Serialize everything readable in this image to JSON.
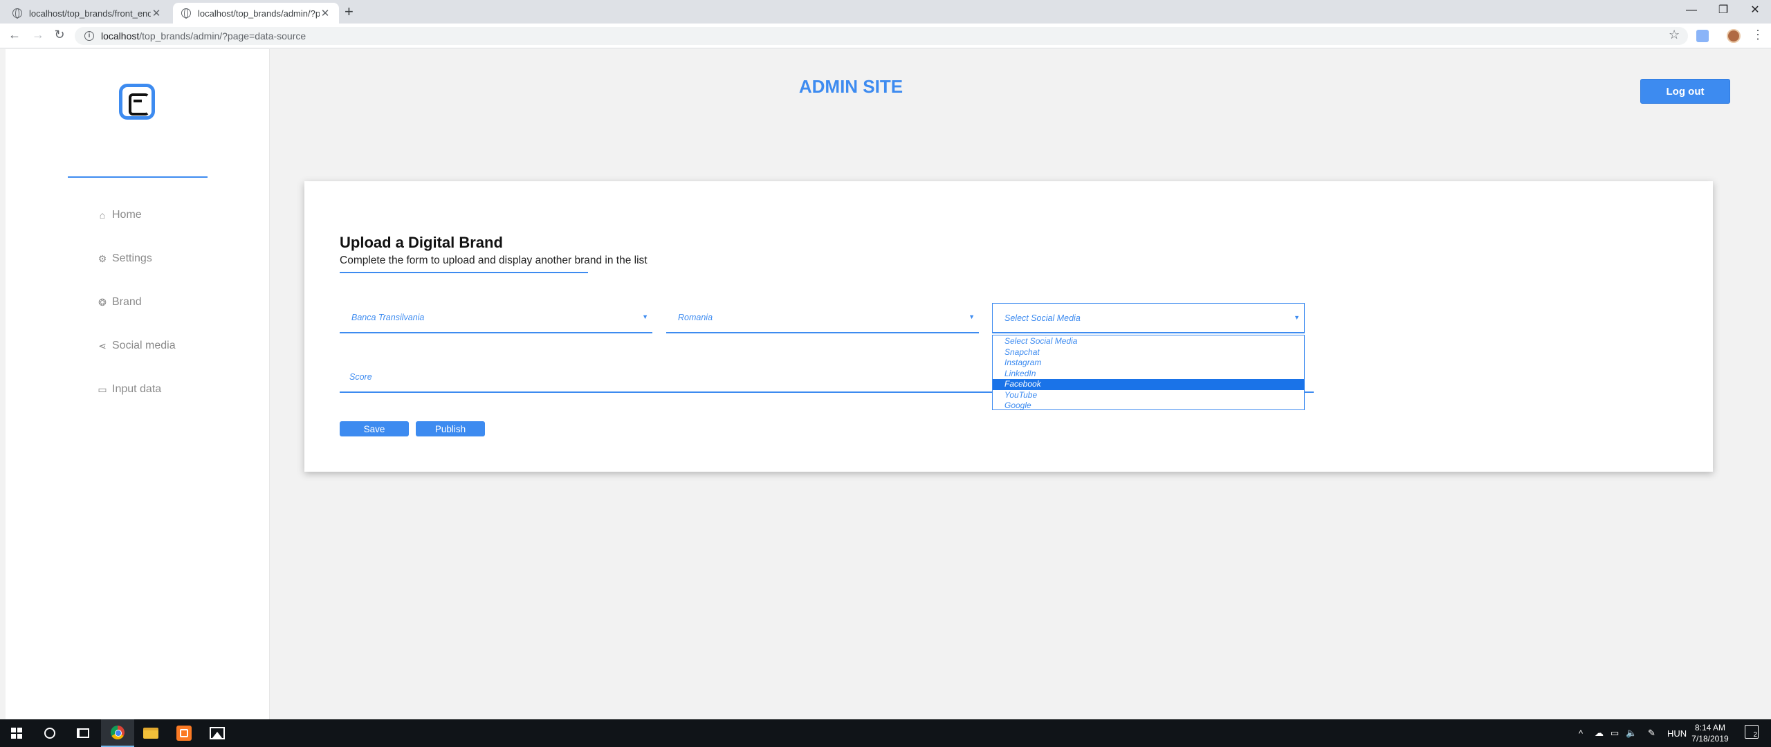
{
  "browser": {
    "tabs": [
      {
        "title": "localhost/top_brands/front_end/",
        "close": "✕"
      },
      {
        "title": "localhost/top_brands/admin/?pa",
        "close": "✕"
      }
    ],
    "new_tab": "+",
    "window_controls": {
      "minimize": "—",
      "restore": "❐",
      "close": "✕"
    },
    "nav": {
      "back": "←",
      "forward": "→",
      "reload": "↻"
    },
    "address": {
      "host": "localhost",
      "path": "/top_brands/admin/?page=data-source",
      "info": "i"
    },
    "bookmark_star": "☆",
    "menu": "⋮"
  },
  "sidebar": {
    "logo": "brand-logo",
    "items": [
      {
        "label": "Home",
        "icon": "⌂",
        "icon_name": "home-icon"
      },
      {
        "label": "Settings",
        "icon": "⚙",
        "icon_name": "gear-icon"
      },
      {
        "label": "Brand",
        "icon": "❂",
        "icon_name": "brand-icon"
      },
      {
        "label": "Social media",
        "icon": "⋖",
        "icon_name": "share-icon"
      },
      {
        "label": "Input data",
        "icon": "▭",
        "icon_name": "folder-icon"
      }
    ]
  },
  "header": {
    "title": "ADMIN SITE",
    "logout_label": "Log out"
  },
  "form": {
    "title": "Upload a Digital Brand",
    "subtitle": "Complete the form to upload and display another brand in the list",
    "brand_select": {
      "value": "Banca Transilvania",
      "arrow": "▼"
    },
    "country_select": {
      "value": "Romania",
      "arrow": "▼"
    },
    "social_select": {
      "value": "Select Social Media",
      "arrow": "▼",
      "options": [
        "Select Social Media",
        "Snapchat",
        "Instagram",
        "LinkedIn",
        "Facebook",
        "YouTube",
        "Google"
      ],
      "highlighted": "Facebook"
    },
    "score_placeholder": "Score",
    "save_label": "Save",
    "publish_label": "Publish"
  },
  "taskbar": {
    "language": "HUN",
    "time": "8:14 AM",
    "date": "7/18/2019",
    "notifications": "2",
    "tray_icons": [
      "^",
      "☁",
      "▭",
      "🔈",
      "✎"
    ]
  },
  "colors": {
    "accent": "#3d8bf0",
    "selected_option": "#1a73e8",
    "page_bg": "#f2f2f2",
    "taskbar": "#101418"
  }
}
